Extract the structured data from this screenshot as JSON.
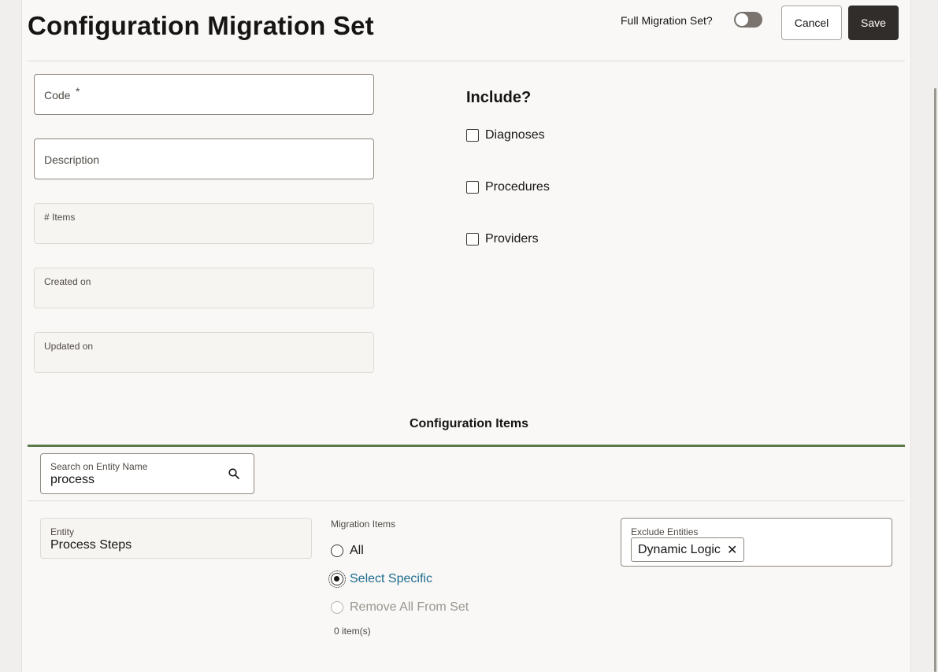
{
  "header": {
    "title": "Configuration Migration Set",
    "full_migration_label": "Full Migration Set?",
    "full_migration_on": false,
    "cancel_label": "Cancel",
    "save_label": "Save"
  },
  "form": {
    "code_label": "Code",
    "code_required_mark": "*",
    "description_label": "Description",
    "items_label": "# Items",
    "created_label": "Created on",
    "updated_label": "Updated on"
  },
  "include": {
    "title": "Include?",
    "options": [
      {
        "label": "Diagnoses",
        "checked": false
      },
      {
        "label": "Procedures",
        "checked": false
      },
      {
        "label": "Providers",
        "checked": false
      }
    ]
  },
  "config_items": {
    "title": "Configuration Items",
    "search_label": "Search on Entity Name",
    "search_value": "process",
    "entity_label": "Entity",
    "entity_value": "Process Steps",
    "migration_items_label": "Migration Items",
    "radio_options": [
      {
        "label": "All",
        "selected": false,
        "disabled": false
      },
      {
        "label": "Select Specific",
        "selected": true,
        "disabled": false
      },
      {
        "label": "Remove All From Set",
        "selected": false,
        "disabled": true
      }
    ],
    "count_text": "0 item(s)",
    "exclude_label": "Exclude Entities",
    "exclude_chips": [
      "Dynamic Logic"
    ]
  },
  "colors": {
    "accent_line": "#5a7a4a",
    "save_button": "#312d2a",
    "link": "#1c6b8e"
  }
}
